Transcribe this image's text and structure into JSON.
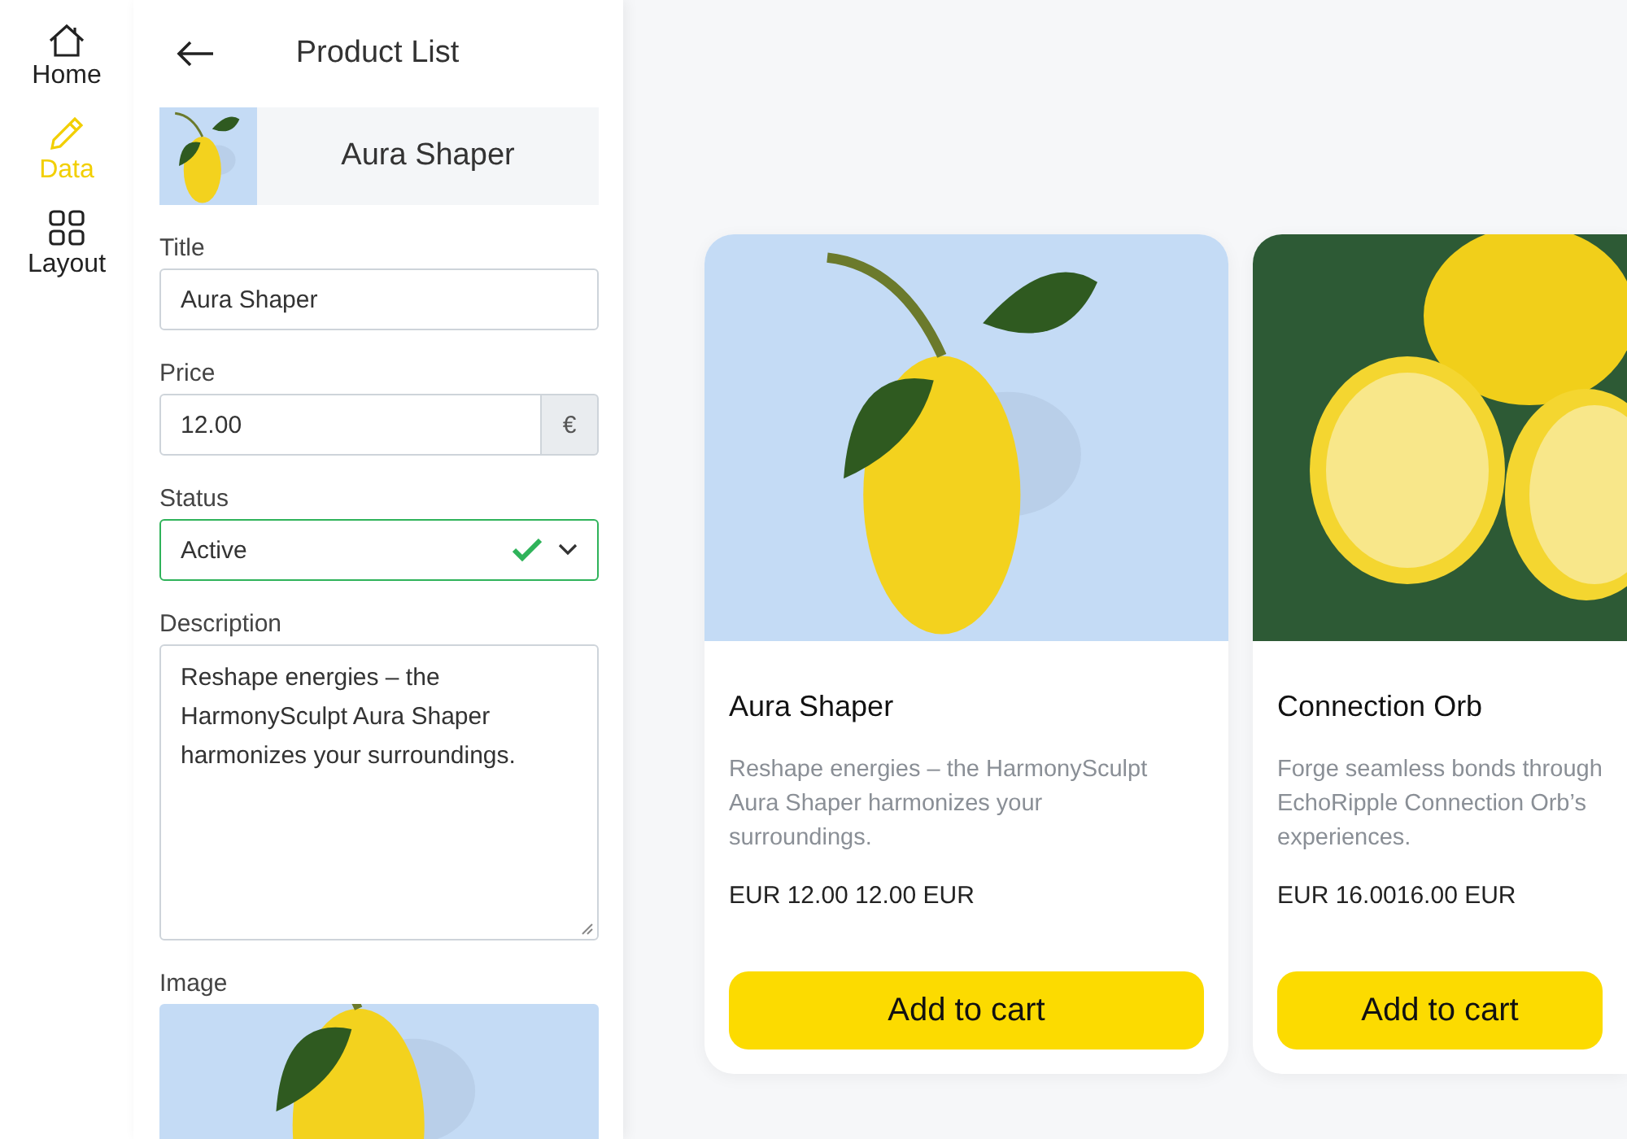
{
  "nav": [
    {
      "label": "Home",
      "kind": "home",
      "selected": false
    },
    {
      "label": "Data",
      "kind": "pencil",
      "selected": true
    },
    {
      "label": "Layout",
      "kind": "grid",
      "selected": false
    }
  ],
  "panel": {
    "title": "Product List",
    "header_item": "Aura Shaper",
    "fields": [
      {
        "kind": "text",
        "label": "Title",
        "value": "Aura Shaper"
      },
      {
        "kind": "price",
        "label": "Price",
        "value": "12.00",
        "addon": "€"
      },
      {
        "kind": "select",
        "label": "Status",
        "value": "Active",
        "valid": true
      },
      {
        "kind": "textarea",
        "label": "Description",
        "value": "Reshape energies – the HarmonySculpt Aura Shaper harmonizes your surroundings."
      },
      {
        "kind": "image",
        "label": "Image"
      }
    ]
  },
  "cards": [
    {
      "kind": "lemon",
      "title": "Aura Shaper",
      "description_lines": [
        "Reshape energies – the HarmonySculpt",
        "Aura Shaper harmonizes your",
        "surroundings."
      ],
      "price": "EUR 12.00 12.00 EUR",
      "button": "Add to cart"
    },
    {
      "kind": "halves",
      "title": "Connection Orb",
      "description_lines": [
        "Forge seamless bonds through",
        "EchoRipple Connection Orb’s",
        "experiences."
      ],
      "price": "EUR 16.0016.00 EUR",
      "button": "Add to cart"
    }
  ]
}
